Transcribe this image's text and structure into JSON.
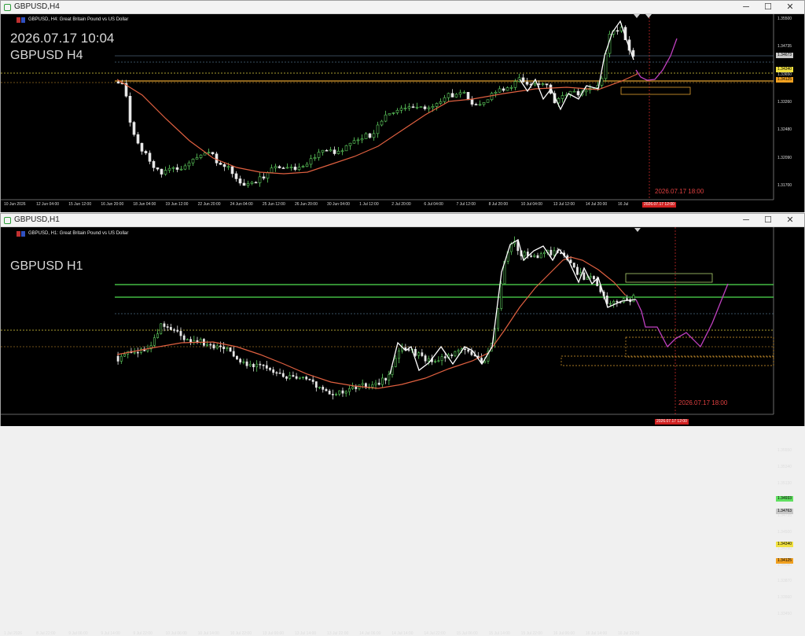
{
  "windows": [
    {
      "id": "h4",
      "window_title": "GBPUSD,H4",
      "header": "GBPUSD, H4:  Great Britain Pound vs US Dollar",
      "overlay_lines": [
        "2026.07.17 10:04",
        "GBPUSD H4"
      ],
      "price_ticks": [
        "1.35500",
        "1.34735",
        "1.33650",
        "1.33260",
        "1.32480",
        "1.32090",
        "1.31700"
      ],
      "tags": [
        {
          "text": "1.34673",
          "color": "#c8c8c8",
          "price": 1.3467
        },
        {
          "text": "1.34340",
          "color": "#f0e040",
          "price": 1.3434
        },
        {
          "text": "1.34125",
          "color": "#f0a020",
          "price": 1.3412
        }
      ],
      "time_ticks": [
        "10 Jun 2026",
        "12 Jun 04:00",
        "15 Jun 12:00",
        "16 Jun 20:00",
        "18 Jun 04:00",
        "19 Jun 12:00",
        "22 Jun 20:00",
        "24 Jun 04:00",
        "25 Jun 12:00",
        "26 Jun 20:00",
        "30 Jun 04:00",
        "1 Jul 12:00",
        "2 Jul 20:00",
        "6 Jul 04:00",
        "7 Jul 12:00",
        "8 Jul 20:00",
        "10 Jul 04:00",
        "13 Jul 12:00",
        "14 Jul 20:00",
        "16 Jul"
      ],
      "time_tag": "2026.07.17 12:00",
      "event_label": "2026.07.17 18:00"
    },
    {
      "id": "h1",
      "window_title": "GBPUSD,H1",
      "header": "GBPUSD, H1:  Great Britain Pound vs US Dollar",
      "overlay_lines": [
        "GBPUSD H1"
      ],
      "price_ticks": [
        "1.35550",
        "1.35340",
        "1.35130",
        "1.34920",
        "1.34735",
        "1.34500",
        "1.34290",
        "1.34080",
        "1.33870",
        "1.33660",
        "1.33450"
      ],
      "tags": [
        {
          "text": "1.34933",
          "color": "#60e060",
          "price": 1.3493
        },
        {
          "text": "1.34763",
          "color": "#c8c8c8",
          "price": 1.3476
        },
        {
          "text": "1.34340",
          "color": "#f0e040",
          "price": 1.3434
        },
        {
          "text": "1.34125",
          "color": "#f0a020",
          "price": 1.3412
        }
      ],
      "time_ticks": [
        "1 Jul 2026",
        "8 Jul 22:00",
        "9 Jul 06:00",
        "9 Jul 14:00",
        "9 Jul 22:00",
        "10 Jul 06:00",
        "10 Jul 14:00",
        "10 Jul 22:00",
        "13 Jul 06:00",
        "13 Jul 14:00",
        "13 Jul 22:00",
        "14 Jul 06:00",
        "14 Jul 14:00",
        "14 Jul 22:00",
        "15 Jul 06:00",
        "15 Jul 14:00",
        "15 Jul 22:00",
        "16 Jul 06:00",
        "16 Jul 14:00",
        "16 Jul 22:00"
      ],
      "time_tag": "2026.07.17 12:00",
      "event_label": "2026.07.17 18:00"
    }
  ],
  "icons": {
    "window": "chart-window-icon",
    "symbol": "flag-icon",
    "minimize": "minimize-icon",
    "maximize": "maximize-icon",
    "close": "close-icon"
  },
  "colors": {
    "bull": "#60d060",
    "bear": "#e8e8e8",
    "ma": "#e06040",
    "zigzag": "#ffffff",
    "projection": "#c040c0",
    "support_green": "#50e050",
    "level_orange": "#e0a030",
    "level_yellow": "#e0d040"
  }
}
